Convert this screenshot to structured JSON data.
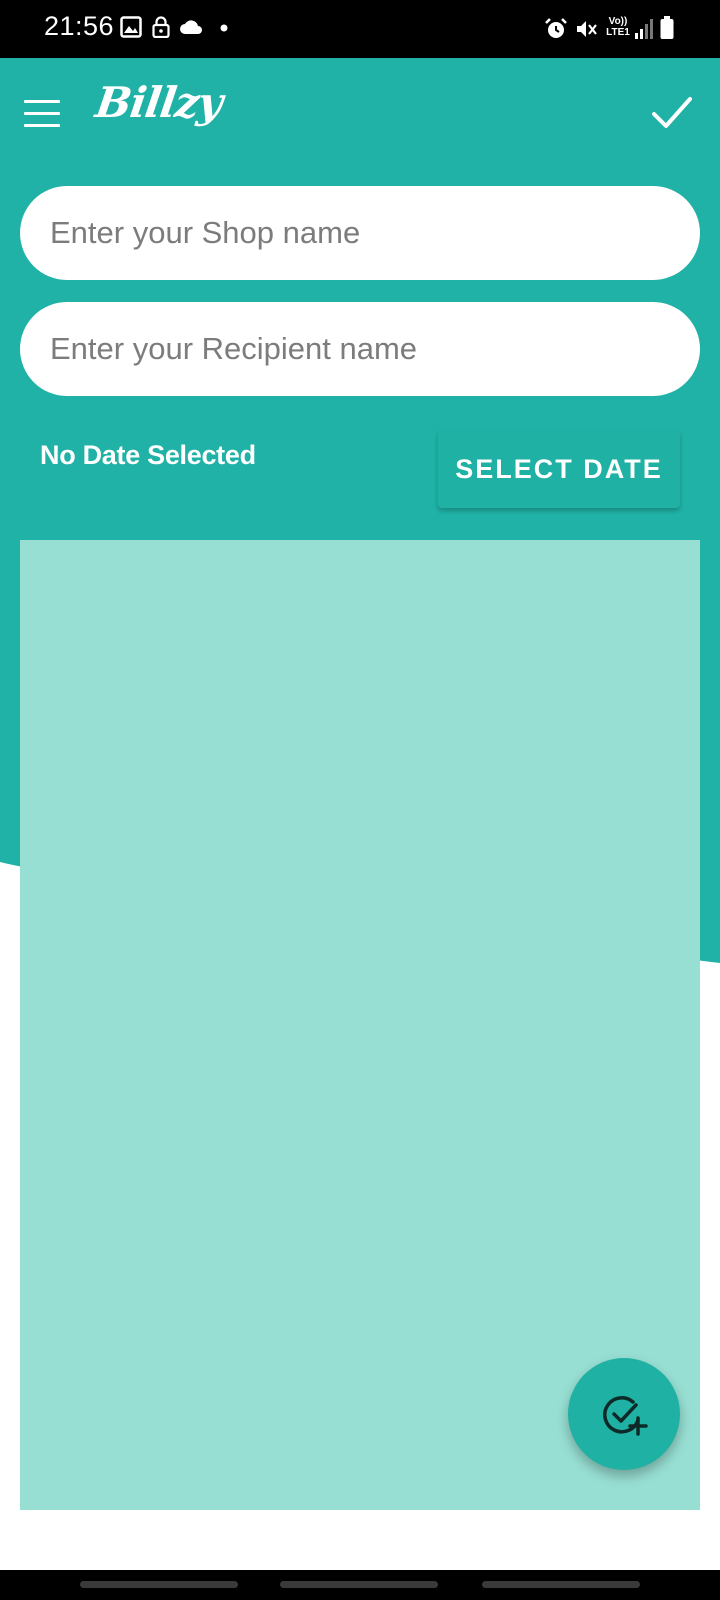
{
  "status_bar": {
    "time": "21:56",
    "left_icons": [
      "image-icon",
      "lock-icon",
      "cloud-icon",
      "dot-icon"
    ],
    "right_icons": [
      "alarm-icon",
      "mute-icon",
      "volte-icon",
      "signal-icon",
      "battery-icon"
    ],
    "volte_text": "Vo))",
    "lte_text": "LTE1"
  },
  "app_bar": {
    "title": "Billzy",
    "menu_icon": "hamburger-menu-icon",
    "action_icon": "check-icon"
  },
  "form": {
    "shop_name": {
      "value": "",
      "placeholder": "Enter your Shop name"
    },
    "recipient_name": {
      "value": "",
      "placeholder": "Enter your Recipient name"
    },
    "date_label": "No Date Selected",
    "select_date_label": "SELECT DATE"
  },
  "fab": {
    "icon": "check-circle-plus-icon"
  },
  "colors": {
    "primary": "#20b2a6",
    "button": "#1fb1a3",
    "items_area": "#98dfd3",
    "status_bar": "#000000",
    "text_on_primary": "#ffffff",
    "placeholder": "#7c7c7c"
  }
}
